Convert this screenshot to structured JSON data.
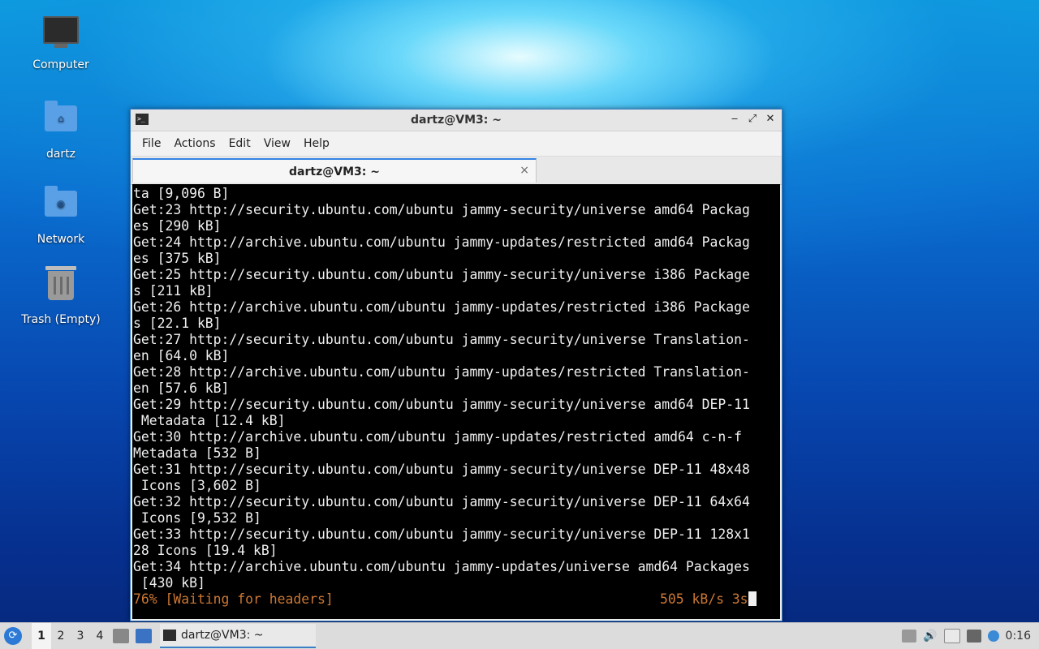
{
  "desktop": {
    "icons": [
      {
        "label": "Computer"
      },
      {
        "label": "dartz"
      },
      {
        "label": "Network"
      },
      {
        "label": "Trash (Empty)"
      }
    ]
  },
  "window": {
    "title": "dartz@VM3: ~",
    "menu": [
      "File",
      "Actions",
      "Edit",
      "View",
      "Help"
    ],
    "tab_label": "dartz@VM3: ~",
    "tab_close": "×",
    "buttons": {
      "minimize": "‒",
      "maximize": "⤢",
      "close": "✕"
    }
  },
  "terminal": {
    "lines": [
      "ta [9,096 B]",
      "Get:23 http://security.ubuntu.com/ubuntu jammy-security/universe amd64 Packag",
      "es [290 kB]",
      "Get:24 http://archive.ubuntu.com/ubuntu jammy-updates/restricted amd64 Packag",
      "es [375 kB]",
      "Get:25 http://security.ubuntu.com/ubuntu jammy-security/universe i386 Package",
      "s [211 kB]",
      "Get:26 http://archive.ubuntu.com/ubuntu jammy-updates/restricted i386 Package",
      "s [22.1 kB]",
      "Get:27 http://security.ubuntu.com/ubuntu jammy-security/universe Translation-",
      "en [64.0 kB]",
      "Get:28 http://archive.ubuntu.com/ubuntu jammy-updates/restricted Translation-",
      "en [57.6 kB]",
      "Get:29 http://security.ubuntu.com/ubuntu jammy-security/universe amd64 DEP-11",
      " Metadata [12.4 kB]",
      "Get:30 http://archive.ubuntu.com/ubuntu jammy-updates/restricted amd64 c-n-f",
      "Metadata [532 B]",
      "Get:31 http://security.ubuntu.com/ubuntu jammy-security/universe DEP-11 48x48",
      " Icons [3,602 B]",
      "Get:32 http://security.ubuntu.com/ubuntu jammy-security/universe DEP-11 64x64",
      " Icons [9,532 B]",
      "Get:33 http://security.ubuntu.com/ubuntu jammy-security/universe DEP-11 128x1",
      "28 Icons [19.4 kB]",
      "Get:34 http://archive.ubuntu.com/ubuntu jammy-updates/universe amd64 Packages",
      " [430 kB]"
    ],
    "status_left": "76% [Waiting for headers]",
    "status_right": "505 kB/s 3s",
    "status_color": "#cc7733"
  },
  "taskbar": {
    "start_icon": "start-menu-icon",
    "workspaces": [
      "1",
      "2",
      "3",
      "4"
    ],
    "active_workspace": "1",
    "task_label": "dartz@VM3: ~",
    "clock": "0:16"
  }
}
